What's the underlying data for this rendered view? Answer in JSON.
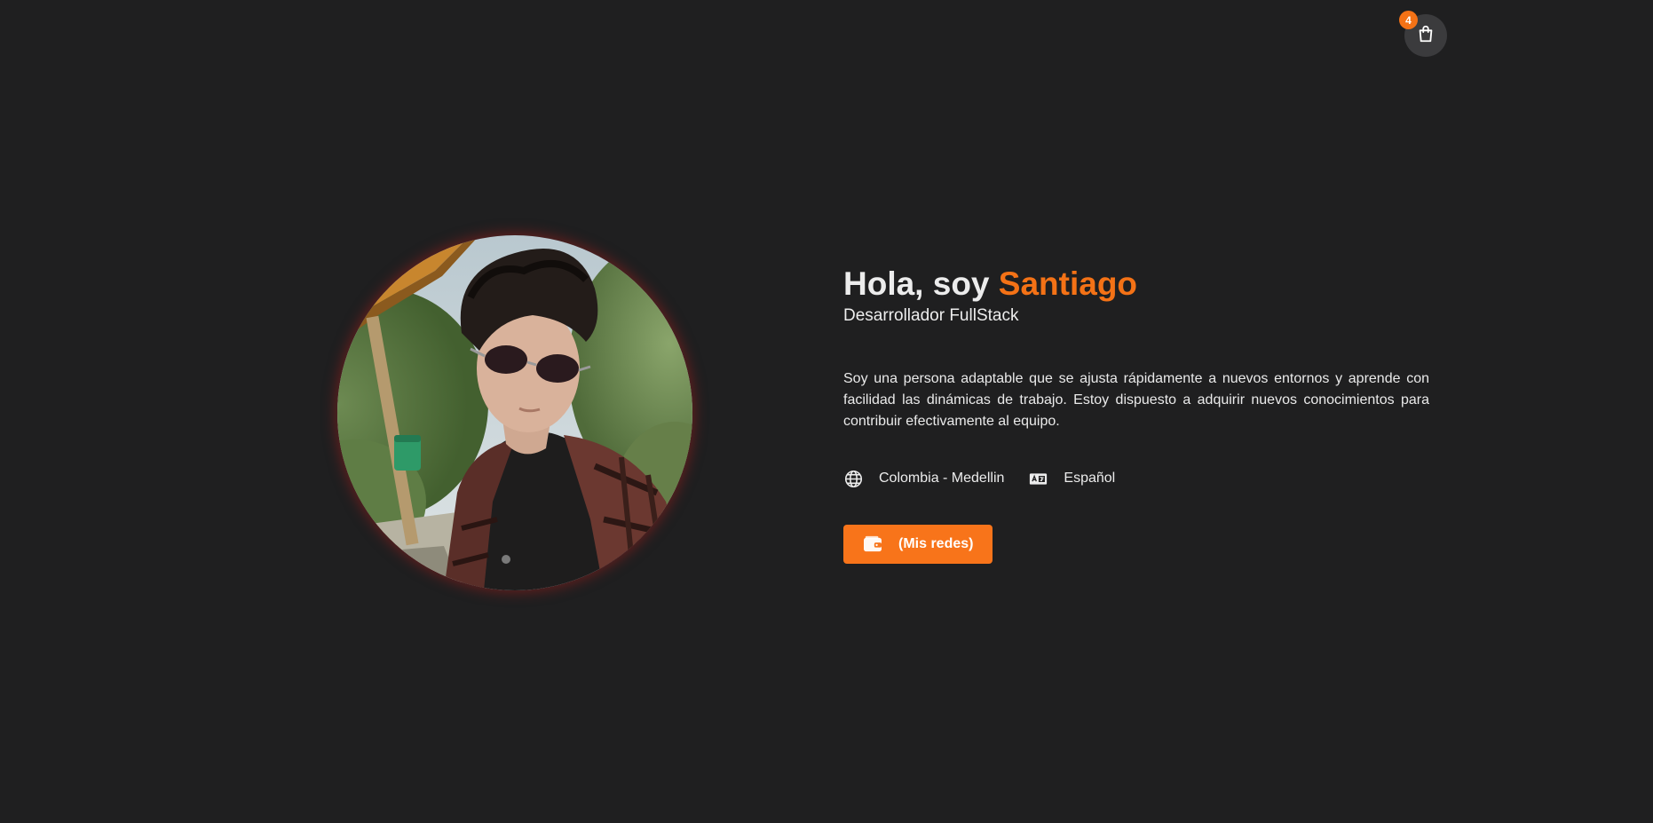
{
  "cart": {
    "icon": "shopping-bag-icon",
    "count": "4"
  },
  "profile": {
    "avatar_icon": "profile-photo",
    "greeting": "Hola, soy",
    "name": "Santiago",
    "role": "Desarrollador FullStack",
    "description": "Soy una persona adaptable que se ajusta rápidamente a nuevos entornos y aprende con facilidad las dinámicas de trabajo. Estoy dispuesto a adquirir nuevos conocimientos para contribuir efectivamente al equipo.",
    "location_icon": "globe-icon",
    "location": "Colombia - Medellin",
    "language_icon": "language-icon",
    "language": "Español"
  },
  "actions": {
    "social_icon": "wallet-icon",
    "social_label": "(Mis redes)"
  },
  "colors": {
    "background": "#1f1f20",
    "accent": "#f47216",
    "text": "#ececec",
    "cart_bg": "#3b3b3d"
  }
}
